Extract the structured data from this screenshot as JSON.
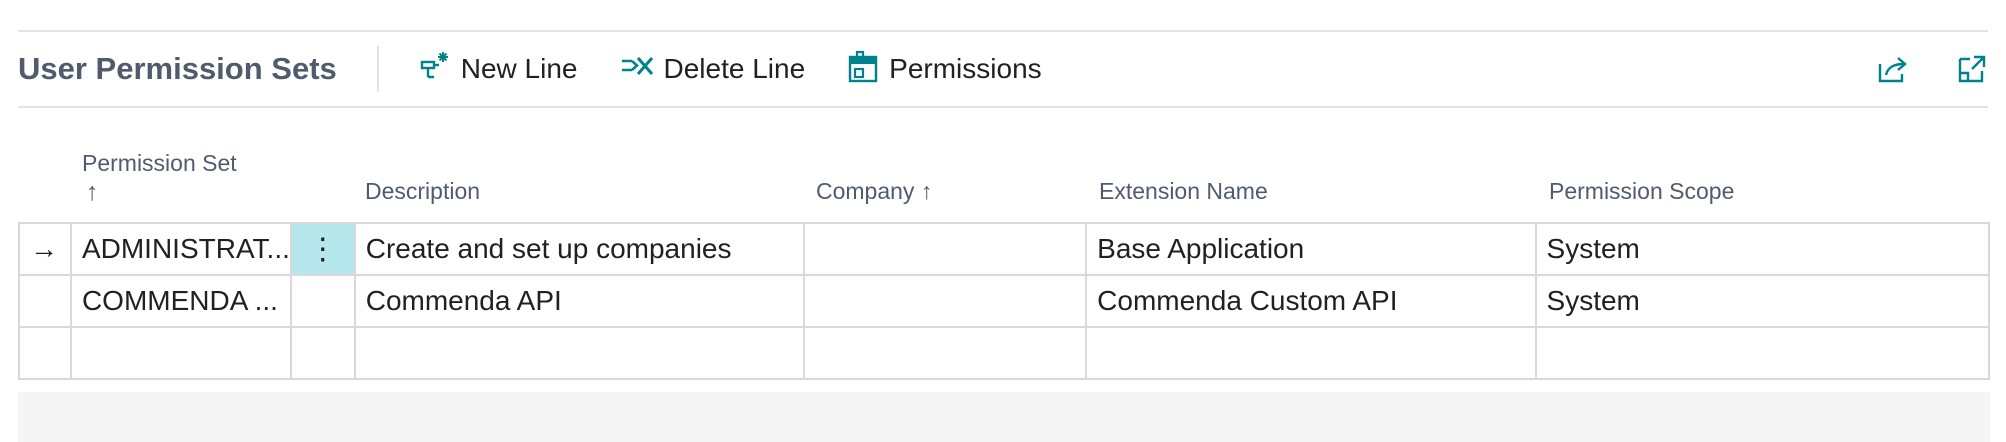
{
  "header": {
    "title": "User Permission Sets"
  },
  "toolbar": {
    "new_line": "New Line",
    "delete_line": "Delete Line",
    "permissions": "Permissions",
    "share_icon": "share-icon",
    "expand_icon": "expand-icon"
  },
  "columns": {
    "permission_set": "Permission Set",
    "permission_set_sort": "↑",
    "description": "Description",
    "company": "Company",
    "company_sort": "↑",
    "extension_name": "Extension Name",
    "permission_scope": "Permission Scope"
  },
  "rows": [
    {
      "indicator": "→",
      "menu": "⋮",
      "permission_set": "ADMINISTRAT...",
      "description": "Create and set up companies",
      "company": "",
      "extension_name": "Base Application",
      "permission_scope": "System"
    },
    {
      "indicator": "",
      "menu": "",
      "permission_set": "COMMENDA ...",
      "description": "Commenda API",
      "company": "",
      "extension_name": "Commenda Custom API",
      "permission_scope": "System"
    },
    {
      "indicator": "",
      "menu": "",
      "permission_set": "",
      "description": "",
      "company": "",
      "extension_name": "",
      "permission_scope": ""
    }
  ],
  "colors": {
    "accent": "#00828c",
    "title": "#505c6d",
    "selected_cell": "#b6e7ec",
    "border": "#d9d9d9"
  }
}
